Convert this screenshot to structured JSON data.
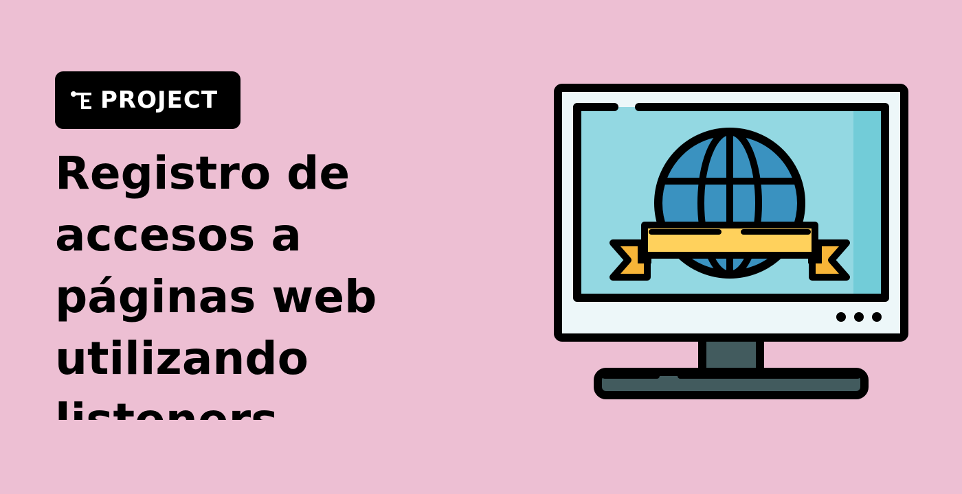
{
  "badge": {
    "label": "PROJECT",
    "icon": "project-tree-icon"
  },
  "hero": {
    "title": "Registro de accesos a páginas web utilizando listeners"
  },
  "illustration": {
    "icon": "monitor-globe-banner-icon"
  },
  "colors": {
    "background": "#EDBFD3",
    "badge_bg": "#000000",
    "screen_sky": "#93D8E2",
    "globe_blue": "#3A92C0",
    "ribbon_yellow": "#FFD15C",
    "ribbon_orange": "#F7B538",
    "monitor_frame": "#EDF7F9",
    "stand_dark": "#425B5E"
  }
}
